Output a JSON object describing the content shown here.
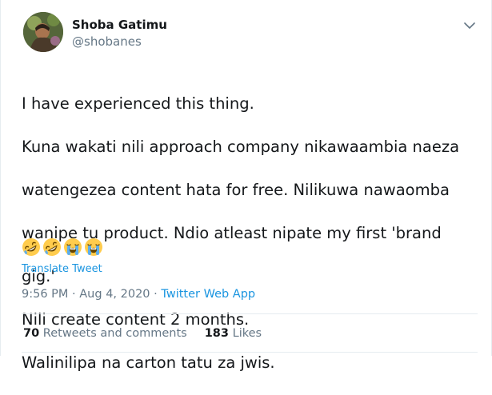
{
  "user": {
    "name": "Shoba Gatimu",
    "handle": "@shobanes"
  },
  "tweet": {
    "lines": [
      "I have experienced this thing.",
      "Kuna wakati nili approach company nikawaambia naeza",
      "watengezea content hata for free. Nilikuwa nawaomba",
      "wanipe tu product. Ndio atleast nipate my first 'brand",
      "gig.'",
      "Nili create content 2 months.",
      "Walinilipa na carton tatu za jwis."
    ],
    "emojis": [
      "rolling-on-floor-laughing",
      "rolling-on-floor-laughing",
      "loudly-crying",
      "loudly-crying"
    ],
    "translate_label": "Translate Tweet",
    "time": "9:56 PM",
    "date": "Aug 4, 2020",
    "separator": " · ",
    "source": "Twitter Web App"
  },
  "stats": {
    "retweets_count": "70",
    "retweets_label": "Retweets and comments",
    "likes_count": "183",
    "likes_label": "Likes"
  },
  "colors": {
    "link": "#1b95e0",
    "secondary_text": "#657786",
    "divider": "#e6ecf0"
  }
}
